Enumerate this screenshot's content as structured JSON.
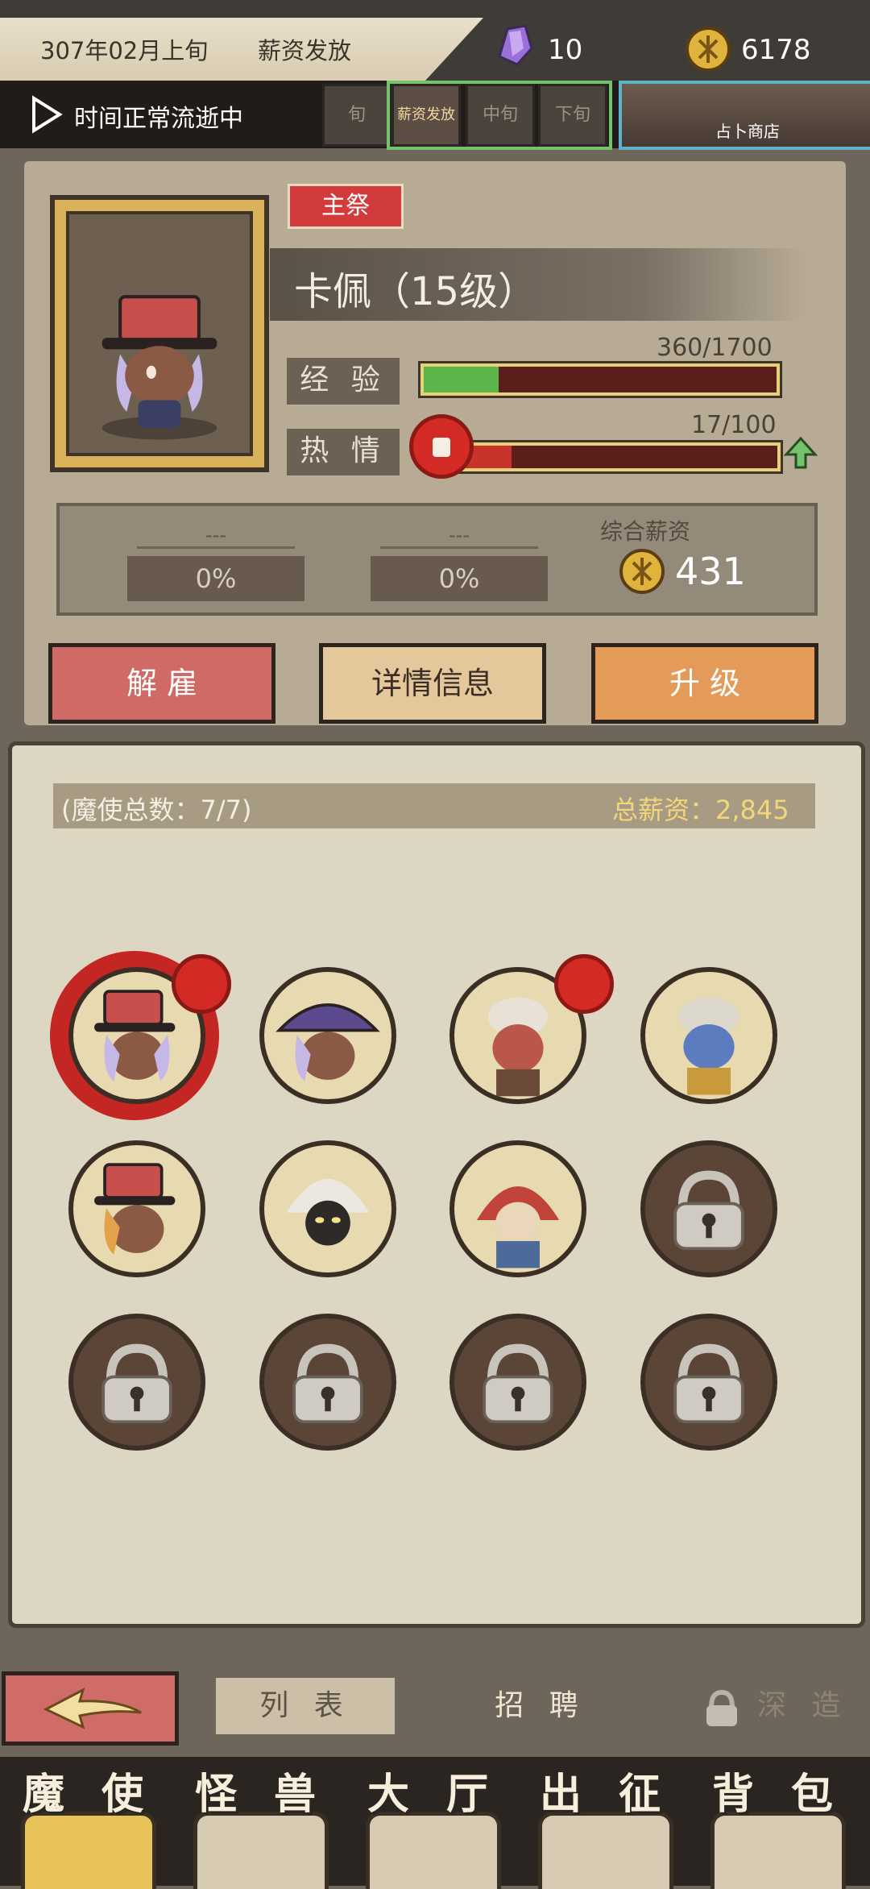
{
  "header": {
    "date": "307年02月上旬",
    "event": "薪资发放",
    "crystals": "10",
    "gold": "6178",
    "time_status": "时间正常流逝中",
    "periods": [
      "旬",
      "薪资发放",
      "中旬",
      "下旬"
    ],
    "shop_label": "占卜商店"
  },
  "character": {
    "role_tag": "主祭",
    "name": "卡佩（15级）",
    "exp_label": "经 验",
    "exp_value": "360/1700",
    "exp_progress": 0.212,
    "passion_label": "热 情",
    "passion_value": "17/100",
    "passion_progress": 0.17,
    "wage_slots": [
      {
        "title": "---",
        "percent": "0%"
      },
      {
        "title": "---",
        "percent": "0%"
      }
    ],
    "total_wage_label": "综合薪资",
    "total_wage_value": "431"
  },
  "actions": {
    "fire": "解 雇",
    "details": "详情信息",
    "upgrade": "升 级"
  },
  "roster": {
    "count": "(魔使总数：7/7)",
    "total_salary": "总薪资：2,845"
  },
  "bottom_tabs": {
    "list": "列 表",
    "recruit": "招 聘",
    "forge": "深 造"
  },
  "nav": [
    "魔 使",
    "怪 兽",
    "大 厅",
    "出 征",
    "背 包"
  ],
  "colors": {
    "exp_fill": "#5cb548",
    "passion_fill": "#c8342c",
    "accent_red": "#d42a26"
  }
}
